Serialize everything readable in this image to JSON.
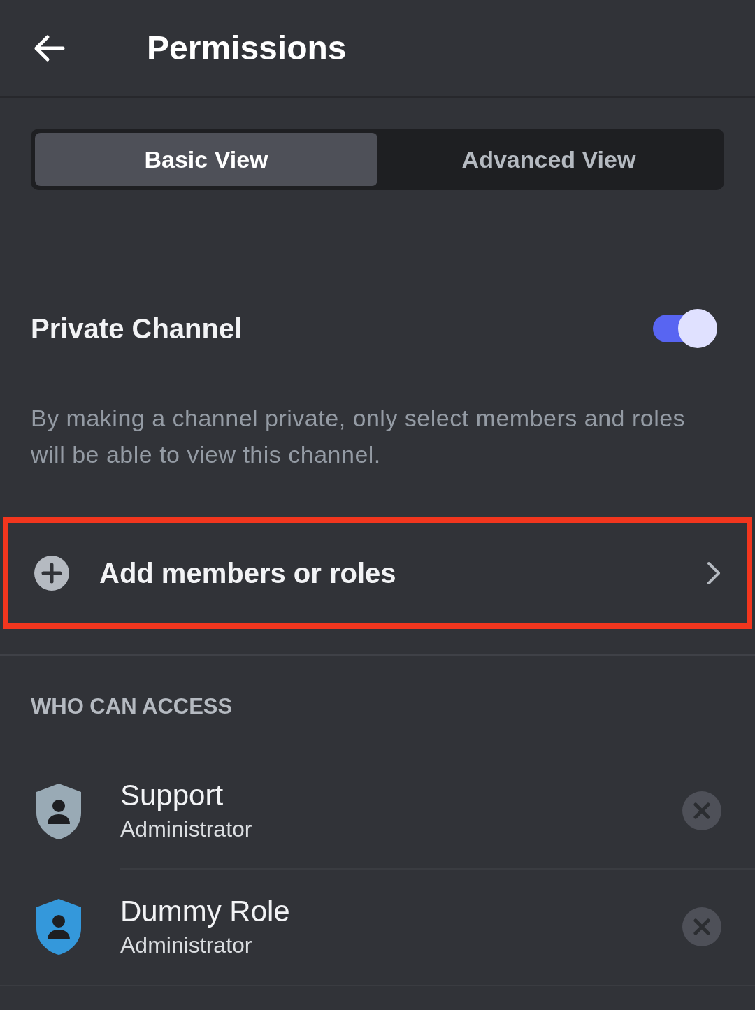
{
  "header": {
    "title": "Permissions"
  },
  "tabs": [
    {
      "label": "Basic View",
      "selected": true
    },
    {
      "label": "Advanced View",
      "selected": false
    }
  ],
  "private_channel": {
    "label": "Private Channel",
    "on": true,
    "description": "By making a channel private, only select members and roles will be able to view this channel."
  },
  "add_row": {
    "label": "Add members or roles",
    "highlighted": true
  },
  "access": {
    "heading": "WHO CAN ACCESS",
    "roles": [
      {
        "name": "Support",
        "permission": "Administrator",
        "color": "#99aab5"
      },
      {
        "name": "Dummy Role",
        "permission": "Administrator",
        "color": "#3498db"
      }
    ]
  }
}
